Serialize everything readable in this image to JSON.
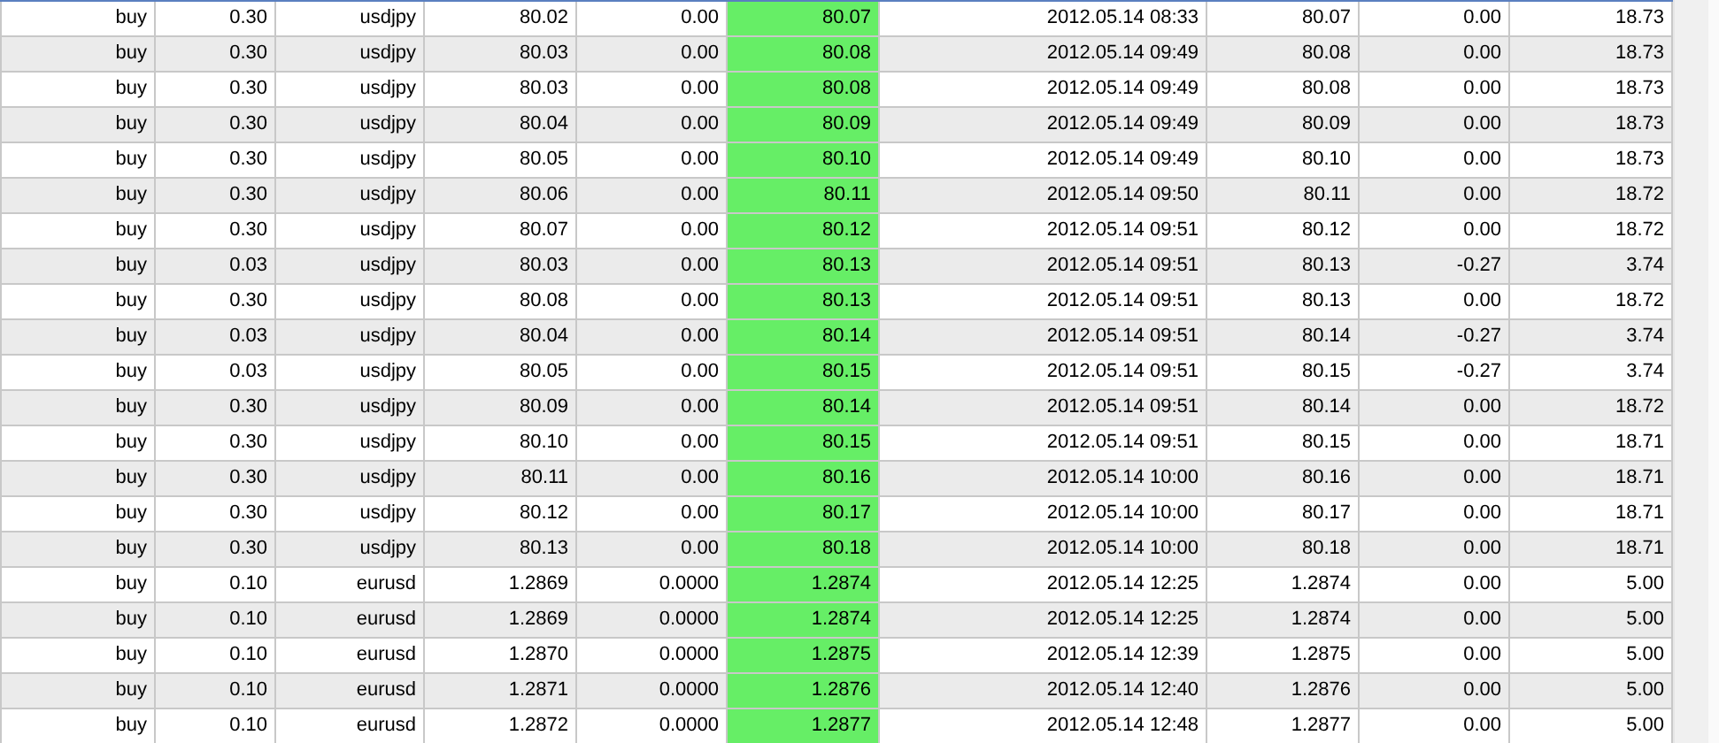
{
  "table": {
    "columns": [
      {
        "highlighted": false
      },
      {
        "highlighted": false
      },
      {
        "highlighted": false
      },
      {
        "highlighted": false
      },
      {
        "highlighted": false
      },
      {
        "highlighted": true
      },
      {
        "highlighted": false
      },
      {
        "highlighted": false
      },
      {
        "highlighted": false
      },
      {
        "highlighted": false
      }
    ],
    "rows": [
      [
        "buy",
        "0.30",
        "usdjpy",
        "80.02",
        "0.00",
        "80.07",
        "2012.05.14 08:33",
        "80.07",
        "0.00",
        "18.73"
      ],
      [
        "buy",
        "0.30",
        "usdjpy",
        "80.03",
        "0.00",
        "80.08",
        "2012.05.14 09:49",
        "80.08",
        "0.00",
        "18.73"
      ],
      [
        "buy",
        "0.30",
        "usdjpy",
        "80.03",
        "0.00",
        "80.08",
        "2012.05.14 09:49",
        "80.08",
        "0.00",
        "18.73"
      ],
      [
        "buy",
        "0.30",
        "usdjpy",
        "80.04",
        "0.00",
        "80.09",
        "2012.05.14 09:49",
        "80.09",
        "0.00",
        "18.73"
      ],
      [
        "buy",
        "0.30",
        "usdjpy",
        "80.05",
        "0.00",
        "80.10",
        "2012.05.14 09:49",
        "80.10",
        "0.00",
        "18.73"
      ],
      [
        "buy",
        "0.30",
        "usdjpy",
        "80.06",
        "0.00",
        "80.11",
        "2012.05.14 09:50",
        "80.11",
        "0.00",
        "18.72"
      ],
      [
        "buy",
        "0.30",
        "usdjpy",
        "80.07",
        "0.00",
        "80.12",
        "2012.05.14 09:51",
        "80.12",
        "0.00",
        "18.72"
      ],
      [
        "buy",
        "0.03",
        "usdjpy",
        "80.03",
        "0.00",
        "80.13",
        "2012.05.14 09:51",
        "80.13",
        "-0.27",
        "3.74"
      ],
      [
        "buy",
        "0.30",
        "usdjpy",
        "80.08",
        "0.00",
        "80.13",
        "2012.05.14 09:51",
        "80.13",
        "0.00",
        "18.72"
      ],
      [
        "buy",
        "0.03",
        "usdjpy",
        "80.04",
        "0.00",
        "80.14",
        "2012.05.14 09:51",
        "80.14",
        "-0.27",
        "3.74"
      ],
      [
        "buy",
        "0.03",
        "usdjpy",
        "80.05",
        "0.00",
        "80.15",
        "2012.05.14 09:51",
        "80.15",
        "-0.27",
        "3.74"
      ],
      [
        "buy",
        "0.30",
        "usdjpy",
        "80.09",
        "0.00",
        "80.14",
        "2012.05.14 09:51",
        "80.14",
        "0.00",
        "18.72"
      ],
      [
        "buy",
        "0.30",
        "usdjpy",
        "80.10",
        "0.00",
        "80.15",
        "2012.05.14 09:51",
        "80.15",
        "0.00",
        "18.71"
      ],
      [
        "buy",
        "0.30",
        "usdjpy",
        "80.11",
        "0.00",
        "80.16",
        "2012.05.14 10:00",
        "80.16",
        "0.00",
        "18.71"
      ],
      [
        "buy",
        "0.30",
        "usdjpy",
        "80.12",
        "0.00",
        "80.17",
        "2012.05.14 10:00",
        "80.17",
        "0.00",
        "18.71"
      ],
      [
        "buy",
        "0.30",
        "usdjpy",
        "80.13",
        "0.00",
        "80.18",
        "2012.05.14 10:00",
        "80.18",
        "0.00",
        "18.71"
      ],
      [
        "buy",
        "0.10",
        "eurusd",
        "1.2869",
        "0.0000",
        "1.2874",
        "2012.05.14 12:25",
        "1.2874",
        "0.00",
        "5.00"
      ],
      [
        "buy",
        "0.10",
        "eurusd",
        "1.2869",
        "0.0000",
        "1.2874",
        "2012.05.14 12:25",
        "1.2874",
        "0.00",
        "5.00"
      ],
      [
        "buy",
        "0.10",
        "eurusd",
        "1.2870",
        "0.0000",
        "1.2875",
        "2012.05.14 12:39",
        "1.2875",
        "0.00",
        "5.00"
      ],
      [
        "buy",
        "0.10",
        "eurusd",
        "1.2871",
        "0.0000",
        "1.2876",
        "2012.05.14 12:40",
        "1.2876",
        "0.00",
        "5.00"
      ],
      [
        "buy",
        "0.10",
        "eurusd",
        "1.2872",
        "0.0000",
        "1.2877",
        "2012.05.14 12:48",
        "1.2877",
        "0.00",
        "5.00"
      ]
    ]
  }
}
